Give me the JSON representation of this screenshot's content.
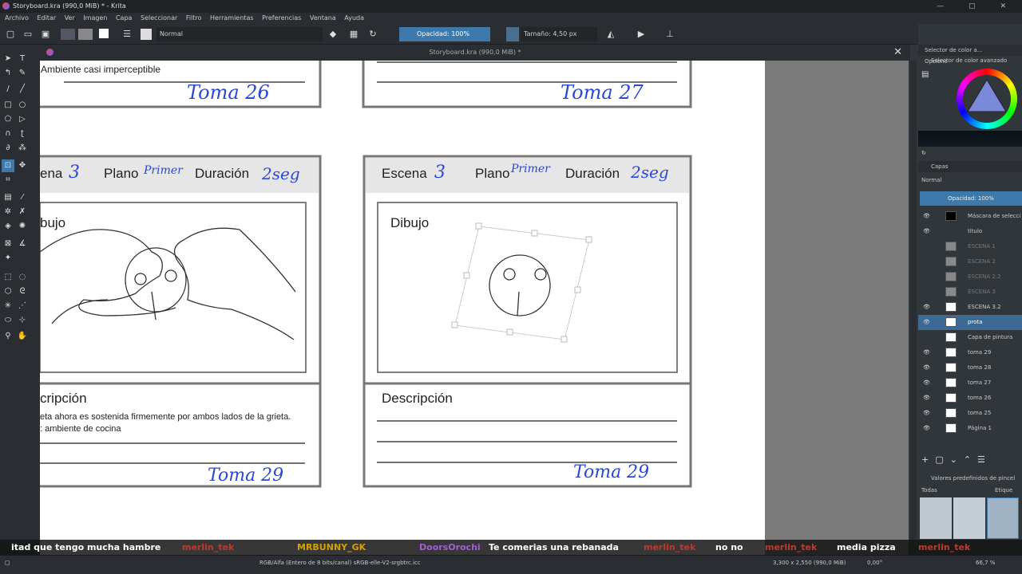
{
  "window": {
    "title": "Storyboard.kra (990,0 MiB) * - Krita"
  },
  "menu": [
    "Archivo",
    "Editar",
    "Ver",
    "Imagen",
    "Capa",
    "Seleccionar",
    "Filtro",
    "Herramientas",
    "Preferencias",
    "Ventana",
    "Ayuda"
  ],
  "toolbar": {
    "blend_mode": "Normal",
    "opacity": "Opacidad: 100%",
    "size": "Tamaño: 4,50 px"
  },
  "document_tab": {
    "title": "Storyboard.kra (990,0 MiB) *"
  },
  "canvas": {
    "top_left": {
      "text": "Ambiente casi imperceptible",
      "toma": "Toma 26"
    },
    "top_right": {
      "toma": "Toma 27"
    },
    "panel_left": {
      "escena": "ena",
      "escena_num": "3",
      "plano": "Plano",
      "plano_hand": "Primer",
      "duracion": "Duración",
      "duracion_hand": "2seg",
      "dibujo": "bujo",
      "descripcion": "cripción",
      "desc_line1": "eta ahora es sostenida firmemente por ambos lados de la grieta.",
      "desc_line2": ": ambiente de cocina",
      "toma": "Toma 29"
    },
    "panel_right": {
      "escena": "Escena",
      "escena_num": "3",
      "plano": "Plano",
      "plano_hand": "Primer",
      "duracion": "Duración",
      "duracion_hand": "2seg",
      "dibujo": "Dibujo",
      "descripcion": "Descripción",
      "toma": "Toma 29"
    }
  },
  "right_panel": {
    "tabs": [
      "Selector de color a...",
      "Opcione"
    ],
    "color_selector_label": "Selector de color avanzado",
    "layers_title": "Capas",
    "layers_blend": "Normal",
    "layers_opacity": "Opacidad: 100%",
    "layers": [
      {
        "name": "Máscara de selecci"
      },
      {
        "name": "titulo"
      },
      {
        "name": "ESCENA 1"
      },
      {
        "name": "ESCENA 2"
      },
      {
        "name": "ESCENA 2.2"
      },
      {
        "name": "ESCENA 3"
      },
      {
        "name": "ESCENA 3.2"
      },
      {
        "name": "prota"
      },
      {
        "name": "Capa de pintura"
      },
      {
        "name": "toma 29"
      },
      {
        "name": "toma 28"
      },
      {
        "name": "toma 27"
      },
      {
        "name": "toma 26"
      },
      {
        "name": "toma 25"
      },
      {
        "name": "Página 1"
      }
    ],
    "brush_presets_title": "Valores predefinidos de pincel",
    "brush_filter": "Todas",
    "brush_tag": "Etique"
  },
  "status": {
    "color_info": "RGB/Alfa (Entero de 8 bits/canal)  sRGB-elle-V2-srgbtrc.icc",
    "dimensions": "3,300 x 2,550 (990,0 MiB)",
    "rotation": "0,00°",
    "zoom": "66,7 %"
  },
  "chat": [
    {
      "user": "",
      "msg": "itad que tengo mucha hambre"
    },
    {
      "user": "merlin_tek",
      "msg": ""
    },
    {
      "user": "MRBUNNY_GK",
      "msg": ""
    },
    {
      "user": "DoorsOrochi",
      "msg": "Te comerias una rebanada"
    },
    {
      "user": "merlin_tek",
      "msg": "no no"
    },
    {
      "user": "merlin_tek",
      "msg": "media pizza"
    },
    {
      "user": "merlin_tek",
      "msg": ""
    }
  ]
}
